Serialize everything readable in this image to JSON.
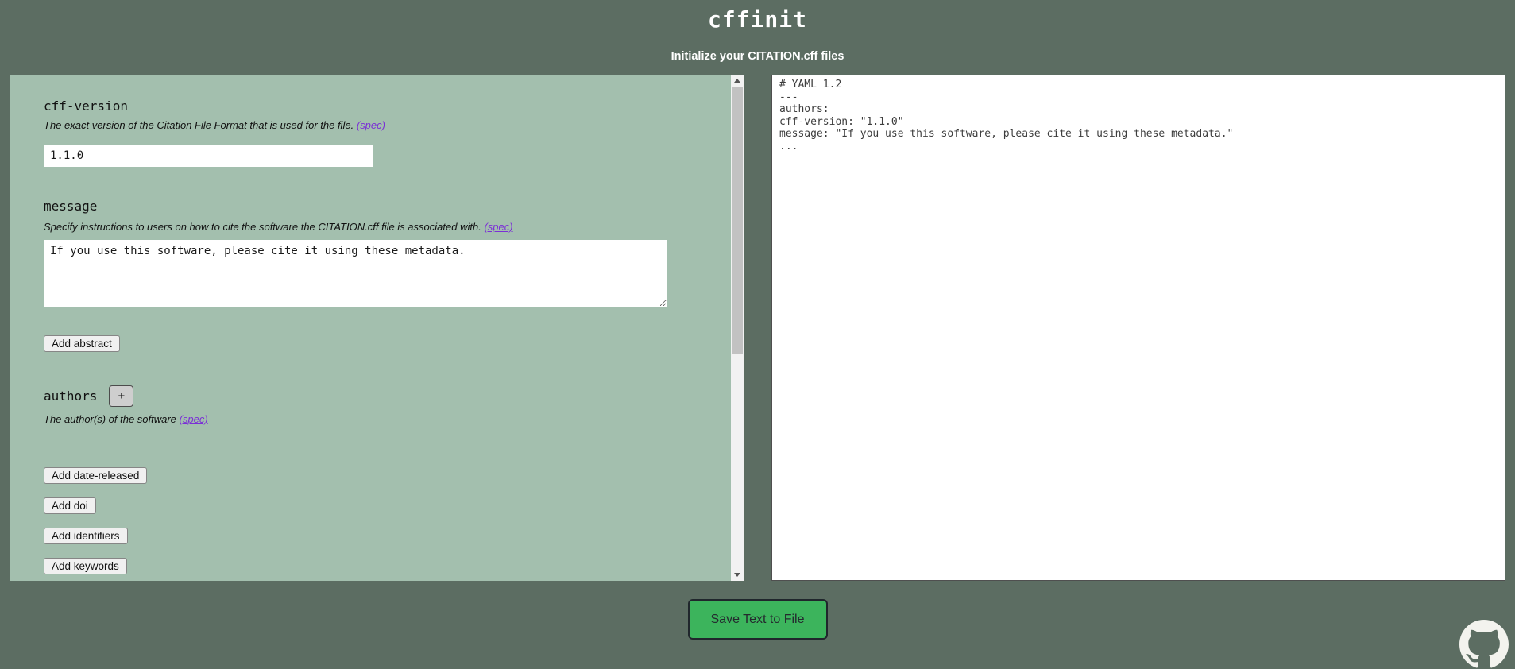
{
  "header": {
    "title": "cffinit",
    "subtitle": "Initialize your CITATION.cff files"
  },
  "form": {
    "cff_version": {
      "label": "cff-version",
      "description": "The exact version of the Citation File Format that is used for the file.",
      "spec_link": "(spec)",
      "value": "1.1.0"
    },
    "message": {
      "label": "message",
      "description": "Specify instructions to users on how to cite the software the CITATION.cff file is associated with.",
      "spec_link": "(spec)",
      "value": "If you use this software, please cite it using these metadata."
    },
    "abstract_button_label": "Add abstract",
    "authors": {
      "label": "authors",
      "add_button_label": "+",
      "description": "The author(s) of the software",
      "spec_link": "(spec)"
    },
    "add_buttons": [
      "Add date-released",
      "Add doi",
      "Add identifiers",
      "Add keywords"
    ]
  },
  "preview": {
    "yaml": "# YAML 1.2\n---\nauthors:\ncff-version: \"1.1.0\"\nmessage: \"If you use this software, please cite it using these metadata.\"\n..."
  },
  "footer": {
    "save_button_label": "Save Text to File",
    "github_icon": "github-mark-icon"
  },
  "colors": {
    "page_background": "#5c6d62",
    "form_panel_background": "#a3bfae",
    "preview_background": "#ffffff",
    "save_button_green": "#3cb45c",
    "spec_link_purple": "#7b2fd6",
    "header_text": "#ffffff"
  }
}
